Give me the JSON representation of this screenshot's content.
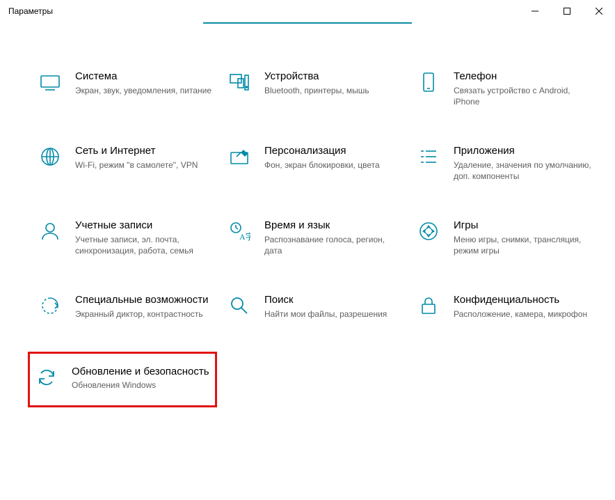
{
  "window": {
    "title": "Параметры"
  },
  "tiles": [
    {
      "id": "system",
      "title": "Система",
      "desc": "Экран, звук, уведомления, питание"
    },
    {
      "id": "devices",
      "title": "Устройства",
      "desc": "Bluetooth, принтеры, мышь"
    },
    {
      "id": "phone",
      "title": "Телефон",
      "desc": "Связать устройство с Android, iPhone"
    },
    {
      "id": "network",
      "title": "Сеть и Интернет",
      "desc": "Wi-Fi, режим \"в самолете\", VPN"
    },
    {
      "id": "personalization",
      "title": "Персонализация",
      "desc": "Фон, экран блокировки, цвета"
    },
    {
      "id": "apps",
      "title": "Приложения",
      "desc": "Удаление, значения по умолчанию, доп. компоненты"
    },
    {
      "id": "accounts",
      "title": "Учетные записи",
      "desc": "Учетные записи, эл. почта, синхронизация, работа, семья"
    },
    {
      "id": "time",
      "title": "Время и язык",
      "desc": "Распознавание голоса, регион, дата"
    },
    {
      "id": "gaming",
      "title": "Игры",
      "desc": "Меню игры, снимки, трансляция, режим игры"
    },
    {
      "id": "ease",
      "title": "Специальные возможности",
      "desc": "Экранный диктор, контрастность"
    },
    {
      "id": "search",
      "title": "Поиск",
      "desc": "Найти мои файлы, разрешения"
    },
    {
      "id": "privacy",
      "title": "Конфиденциальность",
      "desc": "Расположение, камера, микрофон"
    },
    {
      "id": "update",
      "title": "Обновление и безопасность",
      "desc": "Обновления Windows"
    }
  ]
}
